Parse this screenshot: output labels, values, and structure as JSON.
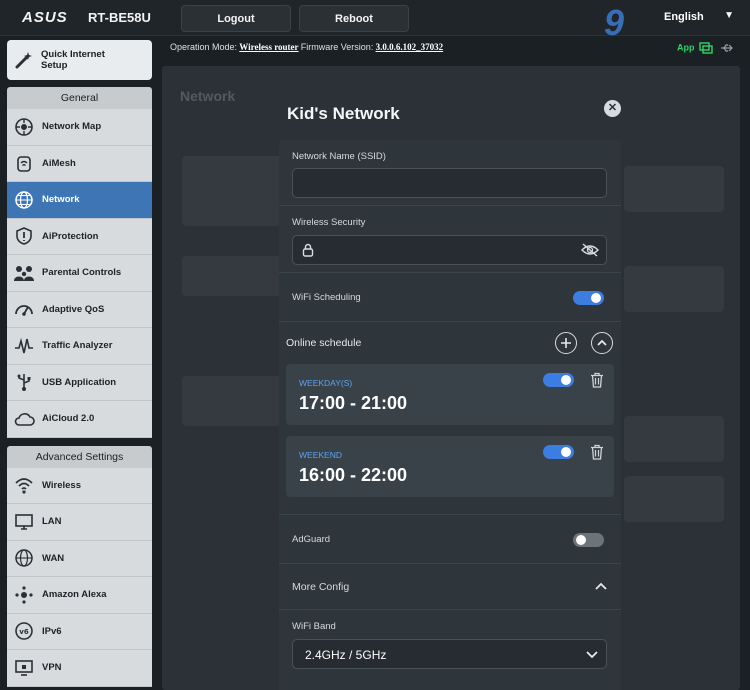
{
  "header": {
    "brand": "ASUS",
    "model": "RT-BE58U",
    "logout_label": "Logout",
    "reboot_label": "Reboot",
    "language": "English",
    "watermark": "9"
  },
  "infobar": {
    "mode_label": "Operation Mode:",
    "mode_value": "Wireless router",
    "fw_label": "Firmware Version:",
    "fw_value": "3.0.0.6.102_37032",
    "app_label": "App"
  },
  "sidebar": {
    "quick_setup_line1": "Quick Internet",
    "quick_setup_line2": "Setup",
    "general_header": "General",
    "general_items": [
      {
        "label": "Network Map",
        "icon": "network-map-icon"
      },
      {
        "label": "AiMesh",
        "icon": "aimesh-icon"
      },
      {
        "label": "Network",
        "icon": "globe-icon",
        "active": true
      },
      {
        "label": "AiProtection",
        "icon": "shield-icon"
      },
      {
        "label": "Parental Controls",
        "icon": "family-icon"
      },
      {
        "label": "Adaptive QoS",
        "icon": "gauge-icon"
      },
      {
        "label": "Traffic Analyzer",
        "icon": "pulse-icon"
      },
      {
        "label": "USB Application",
        "icon": "usb-icon"
      },
      {
        "label": "AiCloud 2.0",
        "icon": "cloud-icon"
      }
    ],
    "advanced_header": "Advanced Settings",
    "advanced_items": [
      {
        "label": "Wireless",
        "icon": "wifi-icon"
      },
      {
        "label": "LAN",
        "icon": "lan-icon"
      },
      {
        "label": "WAN",
        "icon": "wan-globe-icon"
      },
      {
        "label": "Amazon Alexa",
        "icon": "alexa-icon"
      },
      {
        "label": "IPv6",
        "icon": "ipv6-icon"
      },
      {
        "label": "VPN",
        "icon": "vpn-icon"
      }
    ]
  },
  "content": {
    "background_title": "Network"
  },
  "modal": {
    "title": "Kid's Network",
    "ssid_label": "Network Name (SSID)",
    "ssid_value": "",
    "security_label": "Wireless Security",
    "security_value": "",
    "wifi_scheduling_label": "WiFi Scheduling",
    "wifi_scheduling_on": true,
    "online_schedule_label": "Online schedule",
    "schedules": [
      {
        "day": "WEEKDAY(S)",
        "time": "17:00 - 21:00",
        "enabled": true
      },
      {
        "day": "WEEKEND",
        "time": "16:00 - 22:00",
        "enabled": true
      }
    ],
    "adguard_label": "AdGuard",
    "adguard_on": false,
    "more_config_label": "More Config",
    "wifi_band_label": "WiFi Band",
    "wifi_band_value": "2.4GHz / 5GHz"
  },
  "colors": {
    "accent": "#3b7de0",
    "sidebar_active": "#3e76b5",
    "schedule_day": "#5ea2f0",
    "app_green": "#2fd36a"
  }
}
